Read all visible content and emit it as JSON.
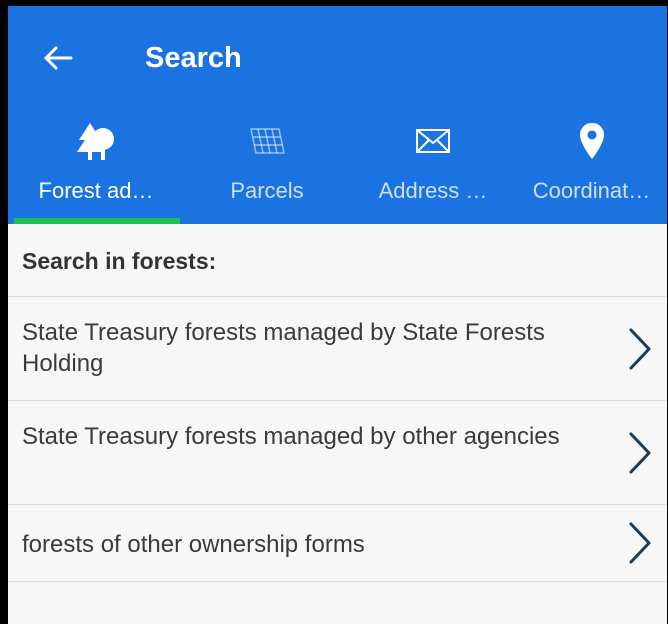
{
  "header": {
    "title": "Search",
    "back_icon": "arrow-left-icon",
    "background_color": "#1a73e0"
  },
  "tabs": [
    {
      "label": "Forest ad…",
      "icon": "trees-icon",
      "active": true
    },
    {
      "label": "Parcels",
      "icon": "grid-icon",
      "active": false
    },
    {
      "label": "Address …",
      "icon": "envelope-icon",
      "active": false
    },
    {
      "label": "Coordinat…",
      "icon": "map-pin-icon",
      "active": false
    }
  ],
  "active_tab_indicator_color": "#1fbf4f",
  "section": {
    "title": "Search in forests:"
  },
  "items": [
    {
      "label": "State Treasury forests managed by State Forests Holding"
    },
    {
      "label": "State Treasury forests managed by other agencies"
    },
    {
      "label": "forests of other ownership forms"
    }
  ],
  "chevron_color": "#1d3b57"
}
